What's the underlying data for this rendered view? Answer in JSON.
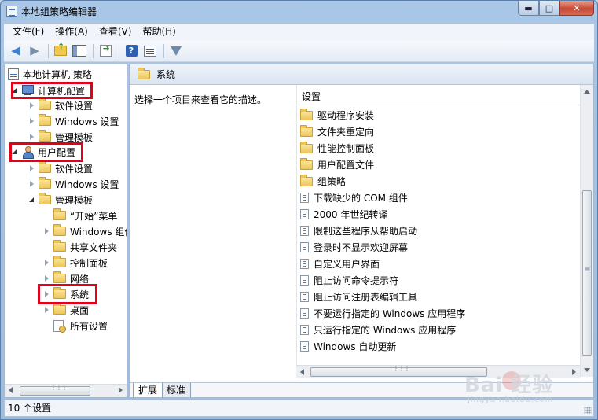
{
  "window": {
    "title": "本地组策略编辑器",
    "minimize_label": "▬",
    "maximize_label": "□",
    "close_label": "✕"
  },
  "menubar": {
    "items": [
      {
        "label": "文件(F)"
      },
      {
        "label": "操作(A)"
      },
      {
        "label": "查看(V)"
      },
      {
        "label": "帮助(H)"
      }
    ]
  },
  "toolbar": {
    "back_icon": "◀",
    "forward_icon": "▶",
    "help_icon": "?"
  },
  "tree": {
    "root": {
      "label": "本地计算机 策略",
      "icon": "policy-root-icon"
    },
    "computer_config": {
      "label": "计算机配置",
      "icon": "computer-icon"
    },
    "computer_children": [
      {
        "label": "软件设置"
      },
      {
        "label": "Windows 设置"
      },
      {
        "label": "管理模板"
      }
    ],
    "user_config": {
      "label": "用户配置",
      "icon": "user-icon"
    },
    "user_children": [
      {
        "label": "软件设置"
      },
      {
        "label": "Windows 设置"
      },
      {
        "label": "管理模板"
      }
    ],
    "admin_template_children": [
      {
        "label": "“开始”菜单"
      },
      {
        "label": "Windows 组件"
      },
      {
        "label": "共享文件夹"
      },
      {
        "label": "控制面板"
      },
      {
        "label": "网络"
      },
      {
        "label": "系统"
      },
      {
        "label": "桌面"
      },
      {
        "label": "所有设置"
      }
    ],
    "highlight_color": "#e2001a"
  },
  "right": {
    "header_title": "系统",
    "description": "选择一个项目来查看它的描述。",
    "column_header": "设置",
    "folders": [
      {
        "label": "驱动程序安装"
      },
      {
        "label": "文件夹重定向"
      },
      {
        "label": "性能控制面板"
      },
      {
        "label": "用户配置文件"
      },
      {
        "label": "组策略"
      }
    ],
    "settings": [
      {
        "label": "下载缺少的 COM 组件"
      },
      {
        "label": "2000 年世纪转译"
      },
      {
        "label": "限制这些程序从帮助启动"
      },
      {
        "label": "登录时不显示欢迎屏幕"
      },
      {
        "label": "自定义用户界面"
      },
      {
        "label": "阻止访问命令提示符"
      },
      {
        "label": "阻止访问注册表编辑工具"
      },
      {
        "label": "不要运行指定的 Windows 应用程序"
      },
      {
        "label": "只运行指定的 Windows 应用程序"
      },
      {
        "label": "Windows 自动更新"
      }
    ],
    "tabs": [
      {
        "label": "扩展"
      },
      {
        "label": "标准"
      }
    ]
  },
  "statusbar": {
    "text": "10 个设置"
  },
  "watermark": {
    "logo": "Bai  经验",
    "sub": "jingyan.baidu.com"
  }
}
